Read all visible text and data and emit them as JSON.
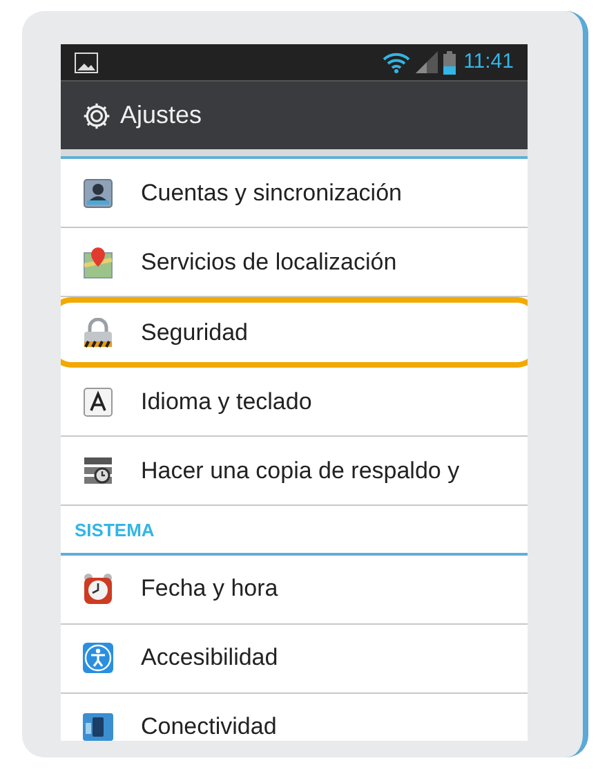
{
  "status_bar": {
    "time": "11:41"
  },
  "action_bar": {
    "title": "Ajustes"
  },
  "sections": [
    {
      "items": [
        {
          "label": "Cuentas y sincronización",
          "highlighted": false
        },
        {
          "label": "Servicios de localización",
          "highlighted": false
        },
        {
          "label": "Seguridad",
          "highlighted": true
        },
        {
          "label": "Idioma y teclado",
          "highlighted": false
        },
        {
          "label": "Hacer una copia de respaldo y",
          "highlighted": false
        }
      ]
    },
    {
      "header": "SISTEMA",
      "items": [
        {
          "label": "Fecha y hora",
          "highlighted": false
        },
        {
          "label": "Accesibilidad",
          "highlighted": false
        },
        {
          "label": "Conectividad",
          "highlighted": false
        }
      ]
    }
  ]
}
